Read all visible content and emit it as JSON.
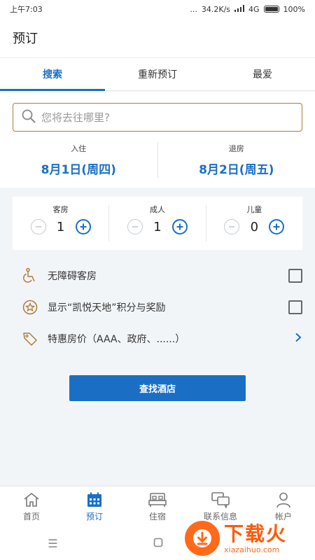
{
  "status_bar": {
    "time": "上午7:03",
    "dots": "...",
    "speed": "34.2K/s",
    "network": "4G",
    "battery": "100%"
  },
  "app_bar": {
    "title": "预订"
  },
  "tabs": [
    {
      "label": "搜索",
      "active": true
    },
    {
      "label": "重新预订",
      "active": false
    },
    {
      "label": "最爱",
      "active": false
    }
  ],
  "search": {
    "placeholder": "您将去往哪里?",
    "value": ""
  },
  "dates": {
    "checkin_label": "入住",
    "checkin_value": "8月1日(周四)",
    "checkout_label": "退房",
    "checkout_value": "8月2日(周五)"
  },
  "guests": {
    "rooms_label": "客房",
    "rooms_value": "1",
    "adults_label": "成人",
    "adults_value": "1",
    "children_label": "儿童",
    "children_value": "0"
  },
  "options": {
    "accessible_label": "无障碍客房",
    "points_label": "显示“凯悦天地”积分与奖励",
    "special_rate_label": "特惠房价（AAA、政府、......）"
  },
  "find_button": {
    "label": "查找酒店"
  },
  "bottom_nav": [
    {
      "label": "首页",
      "icon": "home-icon"
    },
    {
      "label": "预订",
      "icon": "calendar-icon",
      "active": true
    },
    {
      "label": "住宿",
      "icon": "bed-icon"
    },
    {
      "label": "联系信息",
      "icon": "chat-icon"
    },
    {
      "label": "帐户",
      "icon": "user-icon"
    }
  ],
  "watermark": {
    "main": "下载火",
    "sub": "xiazaihuo.com"
  },
  "colors": {
    "accent": "#1a6fc4",
    "option_icon": "#b07a3a",
    "watermark": "#ff5a0a"
  }
}
